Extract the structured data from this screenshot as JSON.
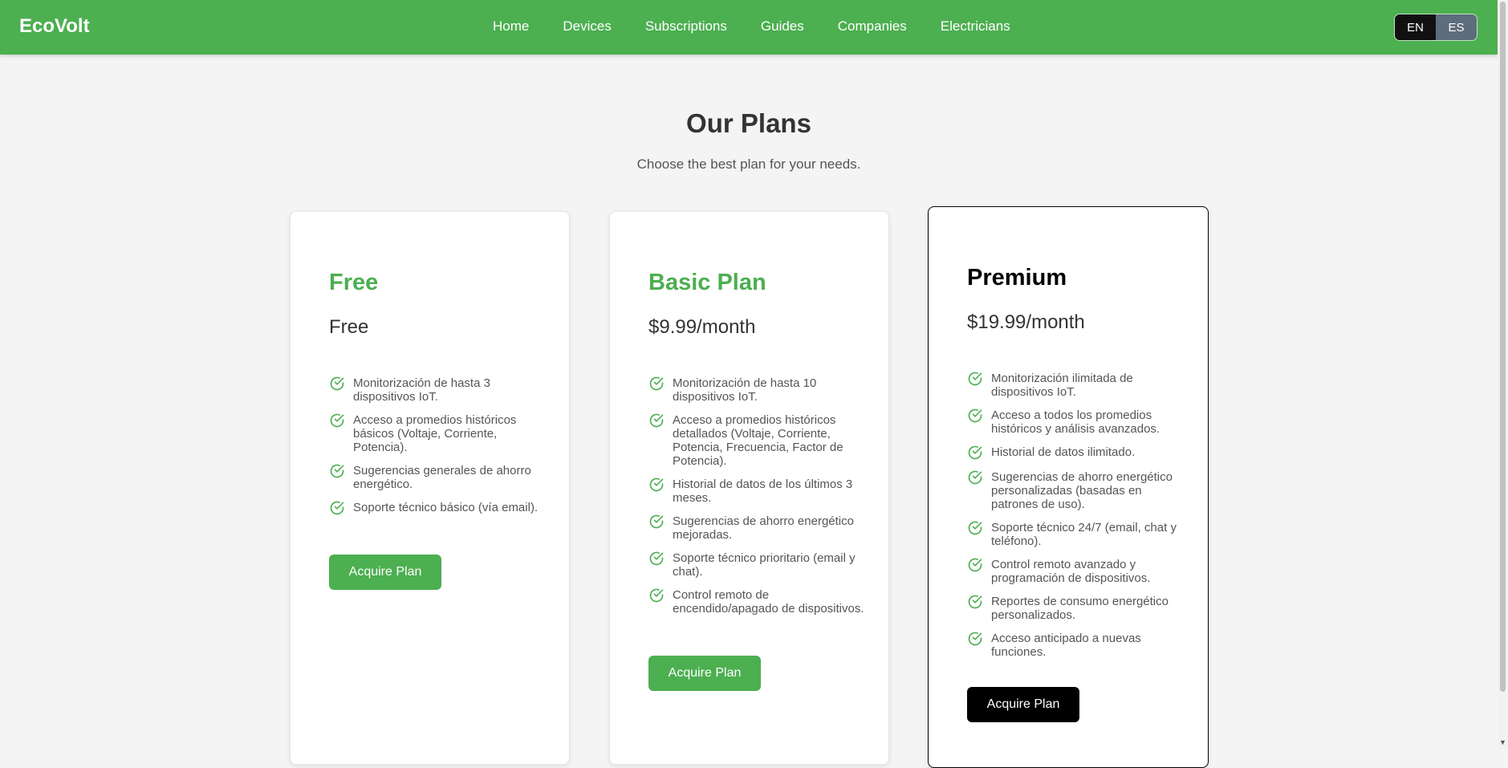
{
  "nav": {
    "brand": "EcoVolt",
    "links": [
      "Home",
      "Devices",
      "Subscriptions",
      "Guides",
      "Companies",
      "Electricians"
    ],
    "lang": {
      "en": "EN",
      "es": "ES",
      "active": "EN"
    }
  },
  "colors": {
    "primary": "#4caf50",
    "featured": "#000000"
  },
  "header": {
    "title": "Our Plans",
    "subtitle": "Choose the best plan for your needs."
  },
  "plans": [
    {
      "name": "Free",
      "price": "Free",
      "features": [
        "Monitorización de hasta 3 dispositivos IoT.",
        "Acceso a promedios históricos básicos (Voltaje, Corriente, Potencia).",
        "Sugerencias generales de ahorro energético.",
        "Soporte técnico básico (vía email)."
      ],
      "button": "Acquire Plan"
    },
    {
      "name": "Basic Plan",
      "price": "$9.99/month",
      "features": [
        "Monitorización de hasta 10 dispositivos IoT.",
        "Acceso a promedios históricos detallados (Voltaje, Corriente, Potencia, Frecuencia, Factor de Potencia).",
        "Historial de datos de los últimos 3 meses.",
        "Sugerencias de ahorro energético mejoradas.",
        "Soporte técnico prioritario (email y chat).",
        "Control remoto de encendido/apagado de dispositivos."
      ],
      "button": "Acquire Plan"
    },
    {
      "name": "Premium",
      "price": "$19.99/month",
      "features": [
        "Monitorización ilimitada de dispositivos IoT.",
        "Acceso a todos los promedios históricos y análisis avanzados.",
        "Historial de datos ilimitado.",
        "Sugerencias de ahorro energético personalizadas (basadas en patrones de uso).",
        "Soporte técnico 24/7 (email, chat y teléfono).",
        "Control remoto avanzado y programación de dispositivos.",
        "Reportes de consumo energético personalizados.",
        "Acceso anticipado a nuevas funciones."
      ],
      "button": "Acquire Plan"
    }
  ]
}
